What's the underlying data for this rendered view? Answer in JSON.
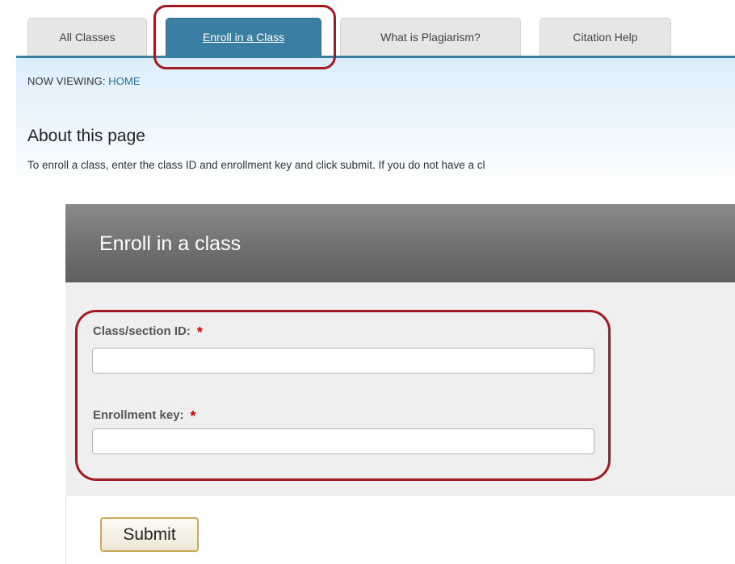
{
  "tabs": [
    {
      "label": "All Classes",
      "active": false
    },
    {
      "label": "Enroll in a Class",
      "active": true
    },
    {
      "label": "What is Plagiarism?",
      "active": false
    },
    {
      "label": "Citation Help",
      "active": false
    }
  ],
  "breadcrumb": {
    "prefix": "NOW VIEWING:",
    "current": "HOME"
  },
  "about": {
    "title": "About this page",
    "text": "To enroll a class, enter the class ID and enrollment key and click submit. If you do not have a cl"
  },
  "enroll_form": {
    "title": "Enroll in a class",
    "class_id_label": "Class/section ID:",
    "class_id_value": "",
    "enrollment_key_label": "Enrollment key:",
    "enrollment_key_value": "",
    "required_marker": "*",
    "submit_label": "Submit"
  },
  "colors": {
    "tab_active": "#3a7ea3",
    "highlight": "#a11a22",
    "required": "#d40000",
    "panel_header": "#6e6e6e"
  }
}
